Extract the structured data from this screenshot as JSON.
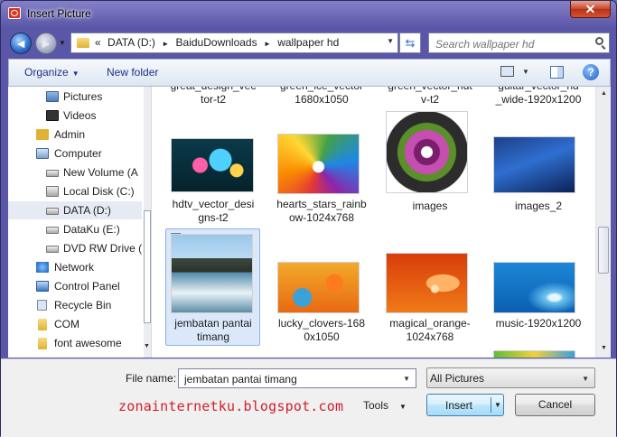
{
  "window": {
    "title": "Insert Picture",
    "close_label": "✕"
  },
  "nav": {
    "back_icon": "back-arrow-icon",
    "forward_icon": "forward-arrow-icon",
    "breadcrumbs": [
      "«",
      "DATA (D:)",
      "►",
      "BaiduDownloads",
      "►",
      "wallpaper hd"
    ],
    "search_placeholder": "Search wallpaper hd"
  },
  "toolbar": {
    "organize_label": "Organize",
    "new_folder_label": "New folder"
  },
  "sidebar": {
    "items": [
      {
        "label": "Pictures",
        "icon": "pictures-icon"
      },
      {
        "label": "Videos",
        "icon": "videos-icon"
      },
      {
        "label": "Admin",
        "icon": "user-folder-icon"
      },
      {
        "label": "Computer",
        "icon": "computer-icon"
      },
      {
        "label": "New Volume (A",
        "icon": "drive-icon"
      },
      {
        "label": "Local Disk (C:)",
        "icon": "system-drive-icon"
      },
      {
        "label": "DATA (D:)",
        "icon": "drive-icon"
      },
      {
        "label": "DataKu (E:)",
        "icon": "drive-icon"
      },
      {
        "label": "DVD RW Drive (",
        "icon": "dvd-drive-icon"
      },
      {
        "label": "Network",
        "icon": "network-icon"
      },
      {
        "label": "Control Panel",
        "icon": "control-panel-icon"
      },
      {
        "label": "Recycle Bin",
        "icon": "recycle-bin-icon"
      },
      {
        "label": "COM",
        "icon": "folder-icon"
      },
      {
        "label": "font awesome",
        "icon": "folder-icon"
      }
    ]
  },
  "files": {
    "row0": [
      {
        "caption": "great_design_vec\ntor-t2"
      },
      {
        "caption": "green_ice_vector\n1680x1050"
      },
      {
        "caption": "green_vector_hdt\nv-t2"
      },
      {
        "caption": "guitar_vector_hd\n_wide-1920x1200"
      }
    ],
    "row1": [
      {
        "caption": "hdtv_vector_desi\ngns-t2"
      },
      {
        "caption": "hearts_stars_rainb\now-1024x768"
      },
      {
        "caption": "images"
      },
      {
        "caption": "images_2"
      }
    ],
    "row2": [
      {
        "caption": "jembatan pantai\ntimang",
        "selected": true
      },
      {
        "caption": "lucky_clovers-168\n0x1050"
      },
      {
        "caption": "magical_orange-\n1024x768"
      },
      {
        "caption": "music-1920x1200"
      }
    ]
  },
  "bottom": {
    "file_name_label": "File name:",
    "file_name_value": "jembatan pantai timang",
    "filter_value": "All Pictures",
    "watermark": "zonainternetku.blogspot.com",
    "tools_label": "Tools",
    "insert_label": "Insert",
    "cancel_label": "Cancel"
  }
}
